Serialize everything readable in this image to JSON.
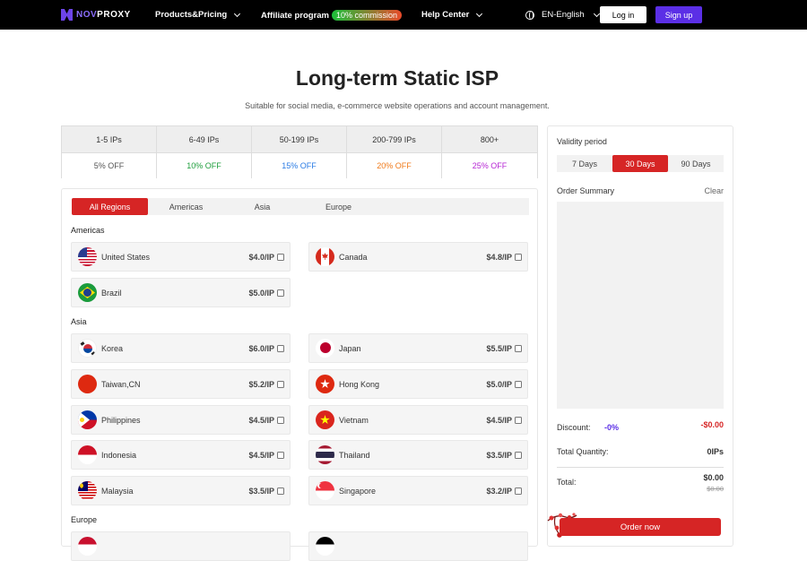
{
  "nav": {
    "logo_nov": "NOV",
    "logo_proxy": "PROXY",
    "products": "Products&Pricing",
    "affiliate": "Affiliate program",
    "commission": "10% commission",
    "help": "Help Center",
    "language": "EN-English",
    "login": "Log in",
    "signup": "Sign up"
  },
  "header": {
    "title": "Long-term Static ISP",
    "subtitle": "Suitable for social media, e-commerce website operations and account management."
  },
  "tiers": [
    {
      "range": "1-5 IPs",
      "discount": "5% OFF",
      "color": "#555555"
    },
    {
      "range": "6-49 IPs",
      "discount": "10% OFF",
      "color": "#1e9e3c"
    },
    {
      "range": "50-199 IPs",
      "discount": "15% OFF",
      "color": "#2a7be4"
    },
    {
      "range": "200-799 IPs",
      "discount": "20% OFF",
      "color": "#f07a1a"
    },
    {
      "range": "800+",
      "discount": "25% OFF",
      "color": "#b626d4"
    }
  ],
  "region_tabs": [
    "All Regions",
    "Americas",
    "Asia",
    "Europe"
  ],
  "sections": {
    "americas": "Americas",
    "asia": "Asia",
    "europe": "Europe"
  },
  "countries": {
    "us": {
      "name": "United States",
      "price": "$4.0/IP"
    },
    "ca": {
      "name": "Canada",
      "price": "$4.8/IP"
    },
    "br": {
      "name": "Brazil",
      "price": "$5.0/IP"
    },
    "kr": {
      "name": "Korea",
      "price": "$6.0/IP"
    },
    "jp": {
      "name": "Japan",
      "price": "$5.5/IP"
    },
    "tw": {
      "name": "Taiwan,CN",
      "price": "$5.2/IP"
    },
    "hk": {
      "name": "Hong Kong",
      "price": "$5.0/IP"
    },
    "ph": {
      "name": "Philippines",
      "price": "$4.5/IP"
    },
    "vn": {
      "name": "Vietnam",
      "price": "$4.5/IP"
    },
    "id": {
      "name": "Indonesia",
      "price": "$4.5/IP"
    },
    "th": {
      "name": "Thailand",
      "price": "$3.5/IP"
    },
    "my": {
      "name": "Malaysia",
      "price": "$3.5/IP"
    },
    "sg": {
      "name": "Singapore",
      "price": "$3.2/IP"
    }
  },
  "summary": {
    "validity_label": "Validity period",
    "periods": [
      "7 Days",
      "30 Days",
      "90 Days"
    ],
    "selected_period": "30 Days",
    "order_summary": "Order Summary",
    "clear": "Clear",
    "discount_label": "Discount:",
    "discount_pct": "-0%",
    "discount_amount": "-$0.00",
    "qty_label": "Total Quantity:",
    "qty_value": "0IPs",
    "total_label": "Total:",
    "total_value": "$0.00",
    "total_original": "$0.00",
    "order_button": "Order now"
  },
  "colors": {
    "accent_red": "#d62525",
    "brand_purple": "#5b2fe6"
  }
}
